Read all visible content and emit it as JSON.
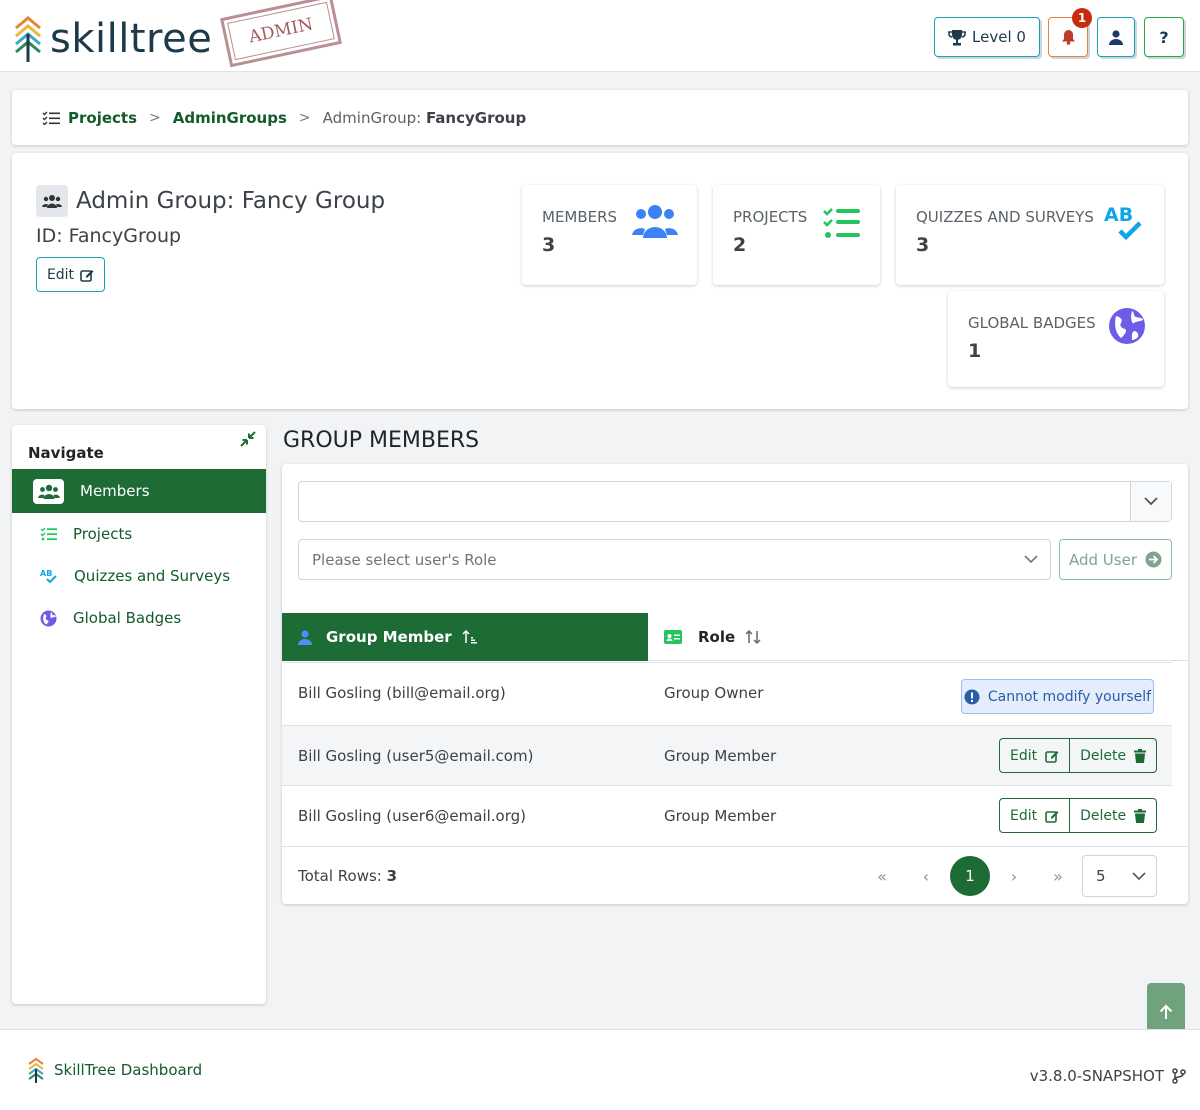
{
  "app": {
    "logo_text": "skilltree",
    "stamp": "ADMIN",
    "level_label": "Level 0",
    "notification_count": "1",
    "help_label": "?"
  },
  "breadcrumb": {
    "items": [
      "Projects",
      "AdminGroups"
    ],
    "current_prefix": "AdminGroup: ",
    "current_value": "FancyGroup"
  },
  "group": {
    "title": "Admin Group: Fancy Group",
    "id_line": "ID: FancyGroup",
    "edit_label": "Edit"
  },
  "stats": [
    {
      "label": "Members",
      "value": "3",
      "icon": "users-icon",
      "color": "#3b82f6"
    },
    {
      "label": "Projects",
      "value": "2",
      "icon": "tasks-list-icon",
      "color": "#22c55e"
    },
    {
      "label": "Quizzes and Surveys",
      "value": "3",
      "icon": "spell-check-icon",
      "color": "#0ea5e9"
    },
    {
      "label": "Global Badges",
      "value": "1",
      "icon": "globe-icon",
      "color": "#6d5ce8"
    }
  ],
  "nav": {
    "heading": "Navigate",
    "items": [
      {
        "label": "Members",
        "icon": "users-icon",
        "active": true
      },
      {
        "label": "Projects",
        "icon": "tasks-list-icon",
        "active": false
      },
      {
        "label": "Quizzes and Surveys",
        "icon": "spell-check-icon",
        "active": false
      },
      {
        "label": "Global Badges",
        "icon": "globe-icon",
        "active": false
      }
    ]
  },
  "members": {
    "section_title": "GROUP MEMBERS",
    "user_select_value": "",
    "role_placeholder": "Please select user's Role",
    "add_user_label": "Add User",
    "columns": [
      "Group Member",
      "Role"
    ],
    "rows": [
      {
        "name": "Bill Gosling (bill@email.org)",
        "role": "Group Owner",
        "action": "Cannot modify yourself"
      },
      {
        "name": "Bill Gosling (user5@email.com)",
        "role": "Group Member",
        "edit": "Edit",
        "delete": "Delete"
      },
      {
        "name": "Bill Gosling (user6@email.org)",
        "role": "Group Member",
        "edit": "Edit",
        "delete": "Delete"
      }
    ],
    "total_label": "Total Rows: ",
    "total_value": "3",
    "current_page": "1",
    "per_page": "5"
  },
  "footer": {
    "brand": "SkillTree Dashboard",
    "version": "v3.8.0-SNAPSHOT"
  },
  "colors": {
    "primary_green": "#1d6b35",
    "link_green": "#135a2c",
    "info": "#17a2b8"
  }
}
